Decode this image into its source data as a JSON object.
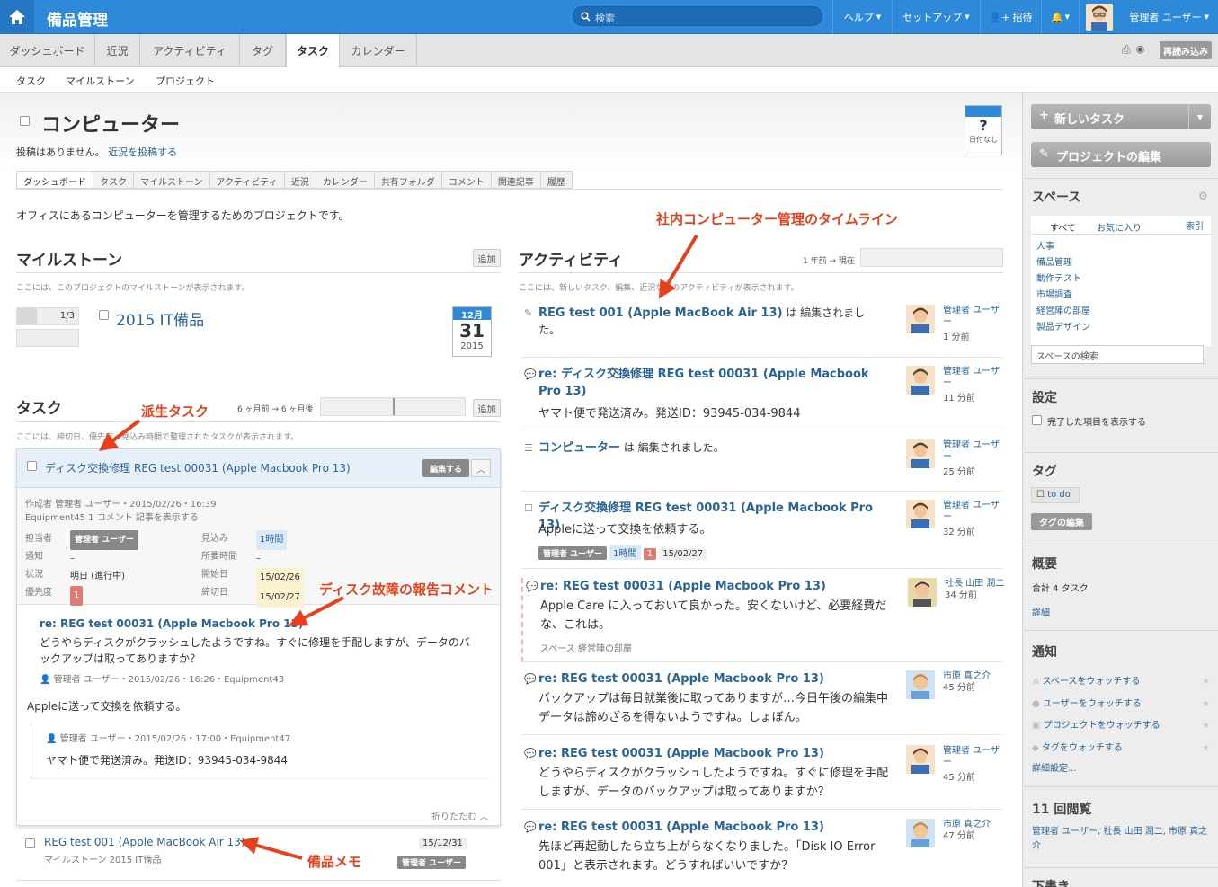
{
  "topbar": {
    "app_name": "備品管理",
    "search_placeholder": "検索",
    "help": "ヘルプ",
    "setup": "セットアップ",
    "invite": "招待",
    "user": "管理者 ユーザー"
  },
  "tabs": [
    "ダッシュボード",
    "近況",
    "アクティビティ",
    "タグ",
    "タスク",
    "カレンダー"
  ],
  "reload_label": "再読み込み",
  "subnav": [
    "タスク",
    "マイルストーン",
    "プロジェクト"
  ],
  "project": {
    "title": "コンピューター",
    "no_posts": "投稿はありません。",
    "post_link": "近況を投稿する",
    "date_badge_icon": "?",
    "date_badge_label": "日付なし",
    "tabs": [
      "ダッシュボード",
      "タスク",
      "マイルストーン",
      "アクティビティ",
      "近況",
      "カレンダー",
      "共有フォルダ",
      "コメント",
      "関連記事",
      "履歴"
    ],
    "description": "オフィスにあるコンピューターを管理するためのプロジェクトです。"
  },
  "milestones": {
    "heading": "マイルストーン",
    "add": "追加",
    "hint": "ここには、このプロジェクトのマイルストーンが表示されます。",
    "progress": "1/3",
    "progress_value": 0.33,
    "name": "2015 IT備品",
    "cal_month": "12月",
    "cal_day": "31",
    "cal_year": "2015"
  },
  "tasks": {
    "heading": "タスク",
    "range": "6 ヶ月前 → 6 ヶ月後",
    "add": "追加",
    "hint": "ここには、締切日、優先度、見込み時間で整理されたタスクが表示されます。",
    "card": {
      "title": "ディスク交換修理 REG test 00031 (Apple Macbook Pro 13)",
      "edit": "編集する",
      "meta1": "作成者 管理者 ユーザー・2015/02/26・16:39",
      "meta2": "Equipment45  1 コメント  記事を表示する",
      "fields": {
        "assignee_label": "担当者",
        "assignee": "管理者 ユーザー",
        "estimate_label": "見込み",
        "estimate": "1時間",
        "notify_label": "通知",
        "notify": "–",
        "required_label": "所要時間",
        "required": "–",
        "status_label": "状況",
        "status": "明日 (進行中)",
        "start_label": "開始日",
        "start": "15/02/26",
        "priority_label": "優先度",
        "priority": "1",
        "due_label": "締切日",
        "due": "15/02/27"
      },
      "comment_title": "re: REG test 00031 (Apple Macbook Pro 13)",
      "comment_body": "どうやらディスクがクラッシュしたようですね。すぐに修理を手配しますが、データのバックアップは取ってありますか？",
      "comment_meta": "管理者 ユーザー・2015/02/26・16:26・Equipment43",
      "reply1": "Appleに送って交換を依頼する。",
      "reply2_meta": "管理者 ユーザー・2015/02/26・17:00・Equipment47",
      "reply2": "ヤマト便で発送済み。発送ID：93945-034-9844",
      "collapse": "折りたたむ"
    },
    "item2_title": "REG test 001 (Apple MacBook Air 13)",
    "item2_sub": "マイルストーン 2015 IT備品",
    "item2_date": "15/12/31",
    "item2_user": "管理者 ユーザー"
  },
  "activity": {
    "heading": "アクティビティ",
    "range": "1 年前 → 現在",
    "hint": "ここには、新しいタスク、編集、近況などのアクティビティが表示されます。",
    "items": [
      {
        "title": "REG test 001 (Apple MacBook Air 13)",
        "suffix": " は 編集されました。",
        "body": "",
        "who": "管理者 ユーザー",
        "when": "1 分前"
      },
      {
        "title": "re: ディスク交換修理 REG test 00031 (Apple Macbook Pro 13)",
        "suffix": "",
        "body": "ヤマト便で発送済み。発送ID：93945-034-9844",
        "who": "管理者 ユーザー",
        "when": "11 分前"
      },
      {
        "title": "コンピューター",
        "suffix": " は 編集されました。",
        "body": "",
        "who": "管理者 ユーザー",
        "when": "25 分前"
      },
      {
        "title": "ディスク交換修理 REG test 00031 (Apple Macbook Pro 13)",
        "suffix": "",
        "body": "Appleに送って交換を依頼する。",
        "tags": [
          "管理者 ユーザー",
          "1時間",
          "1",
          "15/02/27"
        ],
        "who": "管理者 ユーザー",
        "when": "32 分前"
      },
      {
        "title": "re: REG test 00031 (Apple Macbook Pro 13)",
        "suffix": "",
        "body": "Apple Care に入っておいて良かった。安くないけど、必要経費だな、これは。",
        "space": "スペース 経営陣の部屋",
        "who": "社長 山田 潤二",
        "when": "34 分前"
      },
      {
        "title": "re: REG test 00031 (Apple Macbook Pro 13)",
        "suffix": "",
        "body": "バックアップは毎日就業後に取ってありますが…今日午後の編集中データは諦めざるを得ないようですね。しょぼん。",
        "who": "市原 真之介",
        "when": "45 分前"
      },
      {
        "title": "re: REG test 00031 (Apple Macbook Pro 13)",
        "suffix": "",
        "body": "どうやらディスクがクラッシュしたようですね。すぐに修理を手配しますが、データのバックアップは取ってありますか？",
        "who": "管理者 ユーザー",
        "when": "45 分前"
      },
      {
        "title": "re: REG test 00031 (Apple Macbook Pro 13)",
        "suffix": "",
        "body": "先ほど再起動したら立ち上がらなくなりました。「Disk IO Error 001」と表示されます。どうすればいいですか？",
        "who": "市原 真之介",
        "when": "47 分前"
      }
    ]
  },
  "annotations": {
    "timeline": "社内コンピューター管理のタイムライン",
    "derived": "派生タスク",
    "comment": "ディスク故障の報告コメント",
    "memo": "備品メモ"
  },
  "sidebar": {
    "new_task": "新しいタスク",
    "edit_project": "プロジェクトの編集",
    "spaces": "スペース",
    "tab_all": "すべて",
    "tab_fav": "お気に入り",
    "index": "索引",
    "space_items": [
      "人事",
      "備品管理",
      "動作テスト",
      "市場調査",
      "経営陣の部屋",
      "製品デザイン"
    ],
    "space_search": "スペースの検索",
    "settings": "設定",
    "show_done": "完了した項目を表示する",
    "tags": "タグ",
    "tag_todo": "to do",
    "tag_edit": "タグの編集",
    "summary": "概要",
    "summary_total": "合計 4 タスク",
    "details": "詳細",
    "notify": "通知",
    "watch": [
      "スペースをウォッチする",
      "ユーザーをウォッチする",
      "プロジェクトをウォッチする",
      "タグをウォッチする"
    ],
    "detail_settings": "詳細設定...",
    "views": "11 回閲覧",
    "viewers": "管理者 ユーザー, 社長 山田 潤二, 市原 真之介",
    "draft": "下書き"
  }
}
